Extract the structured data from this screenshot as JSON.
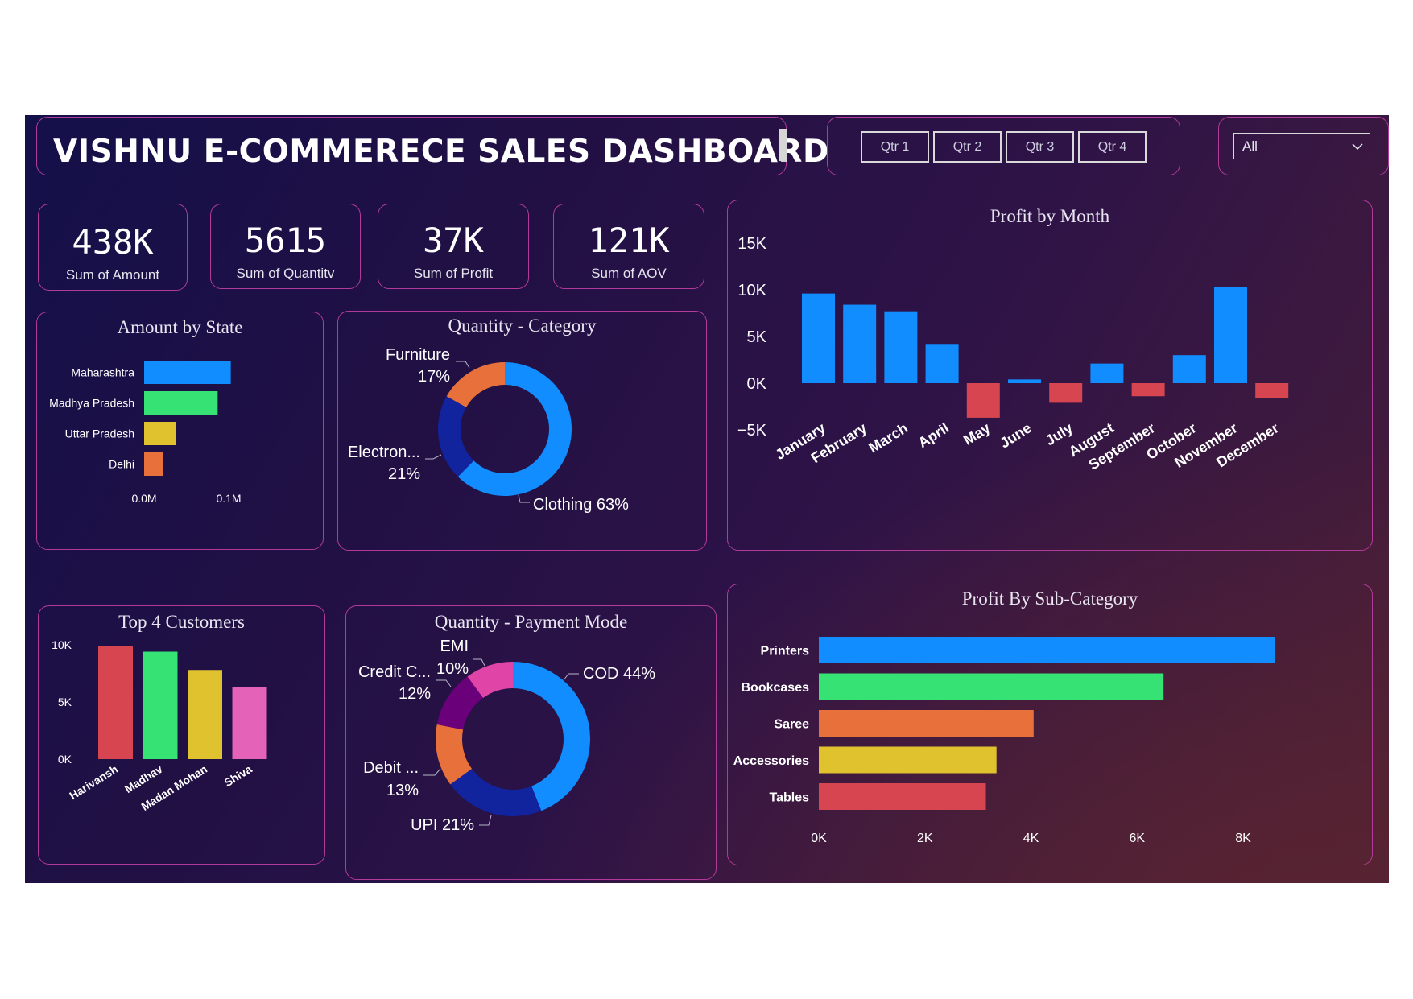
{
  "header": {
    "title": "VISHNU E-COMMERECE SALES DASHBOARD"
  },
  "slicer": {
    "quarters": [
      "Qtr 1",
      "Qtr 2",
      "Qtr 3",
      "Qtr 4"
    ],
    "dropdown_value": "All"
  },
  "kpis": [
    {
      "value": "438K",
      "label": "Sum of Amount"
    },
    {
      "value": "5615",
      "label": "Sum of Quantitv"
    },
    {
      "value": "37K",
      "label": "Sum of Profit"
    },
    {
      "value": "121K",
      "label": "Sum of AOV"
    }
  ],
  "colors": {
    "blue": "#118dff",
    "green": "#37e274",
    "yellow": "#e0c22f",
    "orange": "#e8703a",
    "red": "#d64550",
    "pink": "#e462b8",
    "navy": "#12239e",
    "purple": "#6b007b",
    "magenta": "#e044a7"
  },
  "chart_data": [
    {
      "type": "bar",
      "title": "Amount by State",
      "orientation": "horizontal",
      "categories": [
        "Maharashtra",
        "Madhya Pradesh",
        "Uttar Pradesh",
        "Delhi"
      ],
      "values": [
        0.1025,
        0.087,
        0.038,
        0.022
      ],
      "tick_labels": [
        "0.0M",
        "0.1M"
      ],
      "xlim": [
        0,
        0.1
      ],
      "bar_colors": [
        "#118dff",
        "#37e274",
        "#e0c22f",
        "#e8703a"
      ]
    },
    {
      "type": "pie",
      "title": "Quantity - Category",
      "donut": true,
      "slices": [
        {
          "label": "Clothing",
          "display": "Clothing 63%",
          "percent": 63,
          "color": "#118dff"
        },
        {
          "label": "Electron...",
          "display": "21%",
          "percent": 21,
          "color": "#12239e"
        },
        {
          "label": "Furniture",
          "display": "17%",
          "percent": 17,
          "color": "#e8703a"
        }
      ]
    },
    {
      "type": "bar",
      "title": "Profit by Month",
      "categories": [
        "January",
        "February",
        "March",
        "April",
        "May",
        "June",
        "July",
        "August",
        "September",
        "October",
        "November",
        "December"
      ],
      "values": [
        9600,
        8400,
        7700,
        4200,
        -3700,
        400,
        -2100,
        2100,
        -1400,
        3000,
        10300,
        -1600
      ],
      "ylim": [
        -5000,
        15000
      ],
      "tick_labels": [
        "15K",
        "10K",
        "5K",
        "0K",
        "−5K"
      ],
      "ticks": [
        15000,
        10000,
        5000,
        0,
        -5000
      ],
      "positive_color": "#118dff",
      "negative_color": "#d64550"
    },
    {
      "type": "bar",
      "title": "Top 4 Customers",
      "categories": [
        "Harivansh",
        "Madhav",
        "Madan Mohan",
        "Shiva"
      ],
      "values": [
        9900,
        9400,
        7800,
        6300
      ],
      "ylim": [
        0,
        10000
      ],
      "tick_labels": [
        "10K",
        "5K",
        "0K"
      ],
      "ticks": [
        10000,
        5000,
        0
      ],
      "bar_colors": [
        "#d64550",
        "#37e274",
        "#e0c22f",
        "#e462b8"
      ]
    },
    {
      "type": "pie",
      "title": "Quantity - Payment Mode",
      "donut": true,
      "slices": [
        {
          "label": "COD",
          "display": "COD 44%",
          "percent": 44,
          "color": "#118dff"
        },
        {
          "label": "UPI",
          "display": "UPI 21%",
          "percent": 21,
          "color": "#12239e"
        },
        {
          "label": "Debit ...",
          "display": "13%",
          "percent": 13,
          "color": "#e8703a"
        },
        {
          "label": "Credit C...",
          "display": "12%",
          "percent": 12,
          "color": "#6b007b"
        },
        {
          "label": "EMI",
          "display": "10%",
          "percent": 10,
          "color": "#e044a7"
        }
      ]
    },
    {
      "type": "bar",
      "title": "Profit By Sub-Category",
      "orientation": "horizontal",
      "categories": [
        "Printers",
        "Bookcases",
        "Saree",
        "Accessories",
        "Tables"
      ],
      "values": [
        8600,
        6500,
        4050,
        3350,
        3150
      ],
      "xlim": [
        0,
        8000
      ],
      "tick_labels": [
        "0K",
        "2K",
        "4K",
        "6K",
        "8K"
      ],
      "ticks": [
        0,
        2000,
        4000,
        6000,
        8000
      ],
      "bar_colors": [
        "#118dff",
        "#37e274",
        "#e8703a",
        "#e0c22f",
        "#d64550"
      ]
    }
  ]
}
